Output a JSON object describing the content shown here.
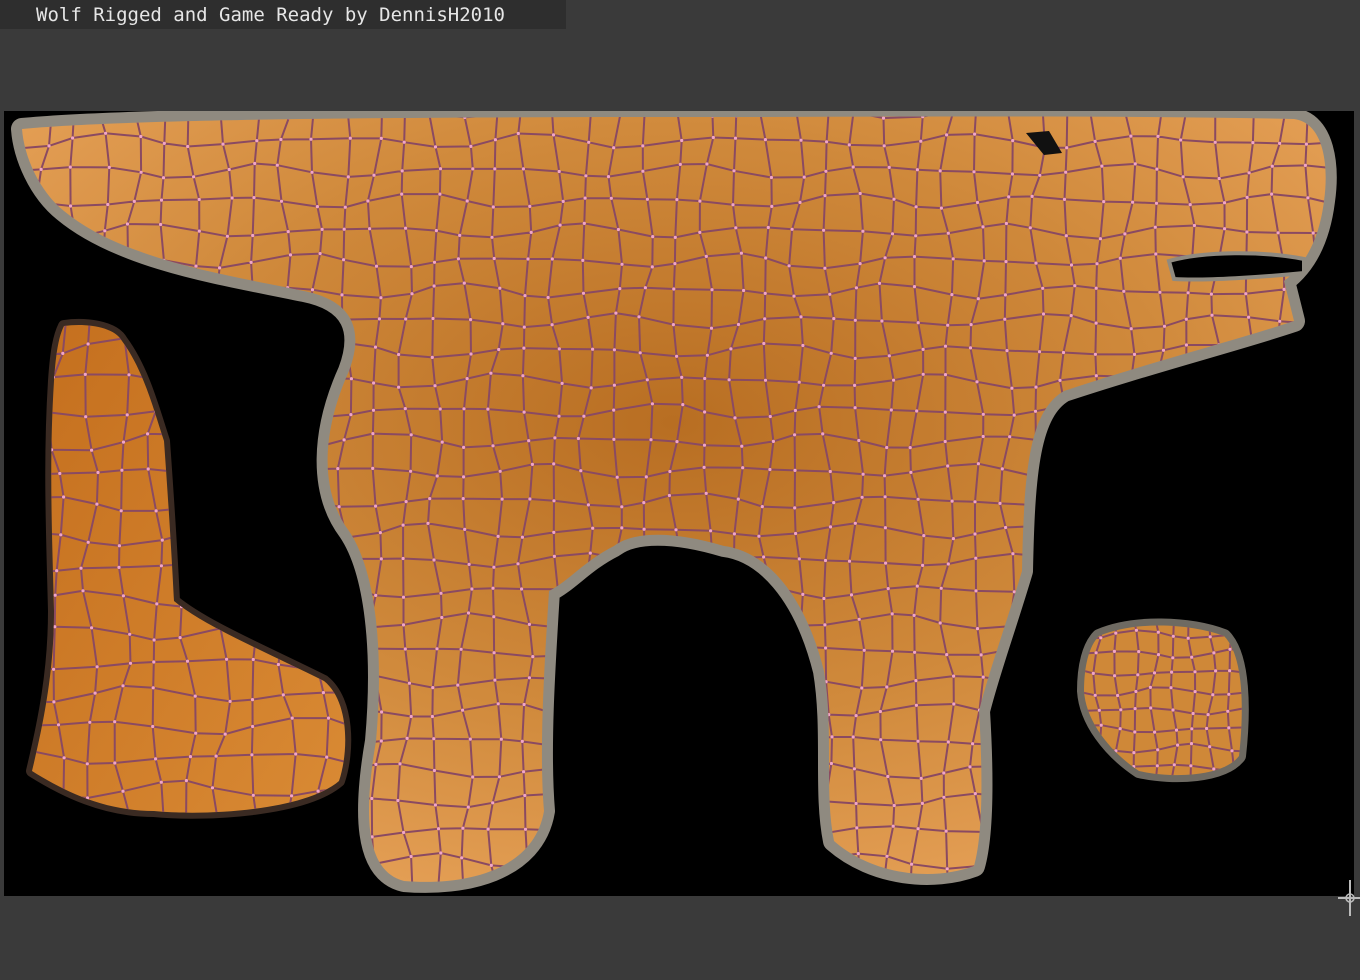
{
  "header": {
    "title": "Wolf Rigged and Game Ready by DennisH2010"
  },
  "viewport": {
    "background_color": "#000000",
    "workspace_color": "#3a3a3a",
    "fur_color": "#d18a3a",
    "wire_color": "#8a4a62",
    "vertex_color": "#f2a6c8",
    "islands": [
      "body-island",
      "leg-island",
      "paw-island"
    ]
  },
  "icons": {
    "cursor": "crosshair-cursor-icon"
  }
}
